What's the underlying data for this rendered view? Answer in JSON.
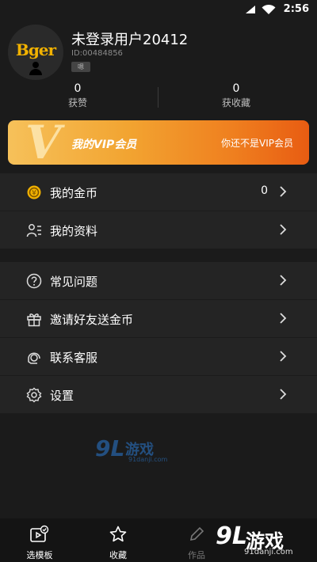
{
  "status_bar": {
    "time": "2:56"
  },
  "profile": {
    "avatar_text": "Bger",
    "username": "未登录用户20412",
    "user_id": "ID:00484856",
    "tag": "嗯",
    "stats": [
      {
        "value": "0",
        "label": "获赞"
      },
      {
        "value": "0",
        "label": "获收藏"
      }
    ]
  },
  "vip": {
    "mark": "V",
    "title": "我的VIP会员",
    "status": "你还不是VIP会员"
  },
  "menu_group_1": [
    {
      "icon": "coin-icon",
      "label": "我的金币",
      "value": "0"
    },
    {
      "icon": "profile-card-icon",
      "label": "我的资料",
      "value": ""
    }
  ],
  "menu_group_2": [
    {
      "icon": "question-icon",
      "label": "常见问题"
    },
    {
      "icon": "gift-icon",
      "label": "邀请好友送金币"
    },
    {
      "icon": "headset-icon",
      "label": "联系客服"
    },
    {
      "icon": "gear-icon",
      "label": "设置"
    }
  ],
  "watermark": {
    "number": "9L",
    "text": "游戏",
    "site": "91danji.com"
  },
  "bottom_tabs": [
    {
      "icon": "template-icon",
      "label": "选模板"
    },
    {
      "icon": "star-icon",
      "label": "收藏"
    },
    {
      "icon": "edit-icon",
      "label": "作品"
    }
  ],
  "brand_overlay": {
    "number": "9L",
    "text": "游戏",
    "site": "91danji.com"
  },
  "colors": {
    "background": "#1b1b1b",
    "menu_bg": "#242424",
    "vip_start": "#f6c15a",
    "vip_end": "#e85c12",
    "logo_gold": "#f2b200"
  }
}
